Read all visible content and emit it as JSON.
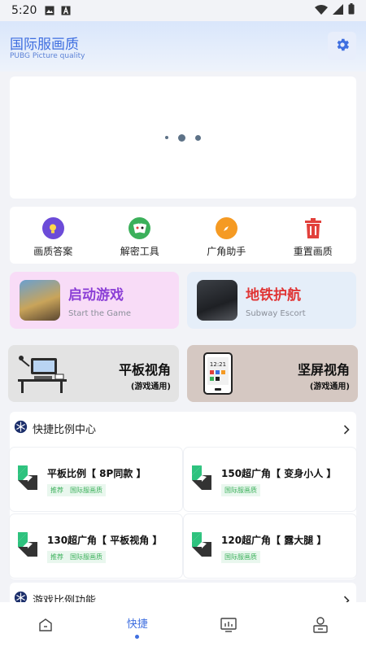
{
  "status_bar": {
    "time": "5:20",
    "icons": [
      "image-icon",
      "a-icon",
      "wifi-icon",
      "signal-icon",
      "battery-icon"
    ]
  },
  "header": {
    "title": "国际服画质",
    "subtitle": "PUBG Picture quality",
    "icon": "gear-icon"
  },
  "banner": {
    "loading_dots": 3
  },
  "tools": [
    {
      "label": "画质答案",
      "icon": "bulb-icon",
      "color": "#6c4bd8"
    },
    {
      "label": "解密工具",
      "icon": "cards-icon",
      "color": "#3bb05a"
    },
    {
      "label": "广角助手",
      "icon": "compass-icon",
      "color": "#f59a23"
    },
    {
      "label": "重置画质",
      "icon": "trash-icon",
      "color": "#e2403b"
    }
  ],
  "games": [
    {
      "title": "启动游戏",
      "subtitle": "Start the Game",
      "title_color": "#8b3fd6",
      "bg": "#f8dcf7"
    },
    {
      "title": "地铁护航",
      "subtitle": "Subway  Escort",
      "title_color": "#e03535",
      "bg": "#e5eef9"
    }
  ],
  "views": [
    {
      "title": "平板视角",
      "subtitle": "(游戏通用)",
      "bg": "#e3e3e3"
    },
    {
      "title": "坚屏视角",
      "subtitle": "(游戏通用)",
      "bg": "#d5c8c2"
    }
  ],
  "quick_ratio": {
    "title": "快捷比例中心",
    "items": [
      {
        "title": "平板比例【 8P同款 】",
        "tags": [
          "推荐",
          "国际服画质"
        ]
      },
      {
        "title": "150超广角【 变身小人 】",
        "tags": [
          "国际服画质"
        ]
      },
      {
        "title": "130超广角【 平板视角 】",
        "tags": [
          "推荐",
          "国际服画质"
        ]
      },
      {
        "title": "120超广角【 露大腿 】",
        "tags": [
          "国际服画质"
        ]
      }
    ]
  },
  "game_ratio": {
    "title": "游戏比例功能"
  },
  "bottom_nav": [
    {
      "icon": "home-icon"
    },
    {
      "label": "快捷",
      "active": true
    },
    {
      "icon": "monitor-icon"
    },
    {
      "icon": "profile-icon"
    }
  ]
}
